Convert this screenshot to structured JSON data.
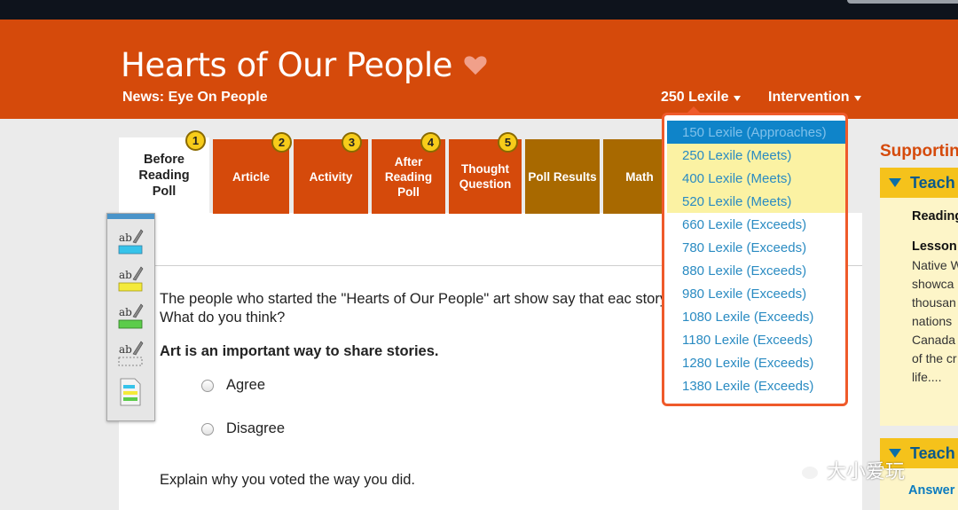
{
  "header": {
    "title": "Hearts of Our People",
    "subtitle": "News: Eye On People",
    "lexile_label": "250 Lexile",
    "intervention_label": "Intervention"
  },
  "tabs": [
    {
      "label": "Before\nReading\nPoll",
      "badge": "1"
    },
    {
      "label": "Article",
      "badge": "2"
    },
    {
      "label": "Activity",
      "badge": "3"
    },
    {
      "label": "After\nReading\nPoll",
      "badge": "4"
    },
    {
      "label": "Thought\nQuestion",
      "badge": "5"
    },
    {
      "label": "Poll Results",
      "badge": ""
    },
    {
      "label": "Math",
      "badge": ""
    }
  ],
  "poll": {
    "question": "The people who started the \"Hearts of Our People\" art show say that eac story. What do you think?",
    "statement": "Art is an important way to share stories.",
    "options": [
      "Agree",
      "Disagree"
    ],
    "explain": "Explain why you voted the way you did."
  },
  "lexile_menu": {
    "items": [
      "150 Lexile (Approaches)",
      "250 Lexile (Meets)",
      "400 Lexile (Meets)",
      "520 Lexile (Meets)",
      "660 Lexile (Exceeds)",
      "780 Lexile (Exceeds)",
      "880 Lexile (Exceeds)",
      "980 Lexile (Exceeds)",
      "1080 Lexile (Exceeds)",
      "1180 Lexile (Exceeds)",
      "1280 Lexile (Exceeds)",
      "1380 Lexile (Exceeds)"
    ],
    "highlighted_index": 0
  },
  "sidebar": {
    "title": "Supporting",
    "panel1_head": "Teach",
    "reading": "Reading",
    "lesson": "Lesson",
    "lesson_lines": [
      "Native W",
      "showca",
      "thousan",
      "nations",
      "Canada",
      "of the cr",
      "life...."
    ],
    "panel2_head": "Teach",
    "answer": "Answer"
  },
  "watermark": "大小爱玩",
  "colors": {
    "header_orange": "#d54a0b",
    "tab_brown": "#a86900",
    "badge_yellow": "#f7cc1a",
    "menu_border": "#ef5a2a",
    "menu_selected": "#0f84c9",
    "menu_highlight": "#fbf2a3",
    "link_blue": "#2a8bc2",
    "sidebar_yellow": "#f5c21b"
  },
  "icons": [
    "heart-icon",
    "caret-down-icon",
    "highlighter-cyan-icon",
    "highlighter-yellow-icon",
    "highlighter-green-icon",
    "eraser-icon",
    "notes-icon",
    "wechat-icon"
  ]
}
